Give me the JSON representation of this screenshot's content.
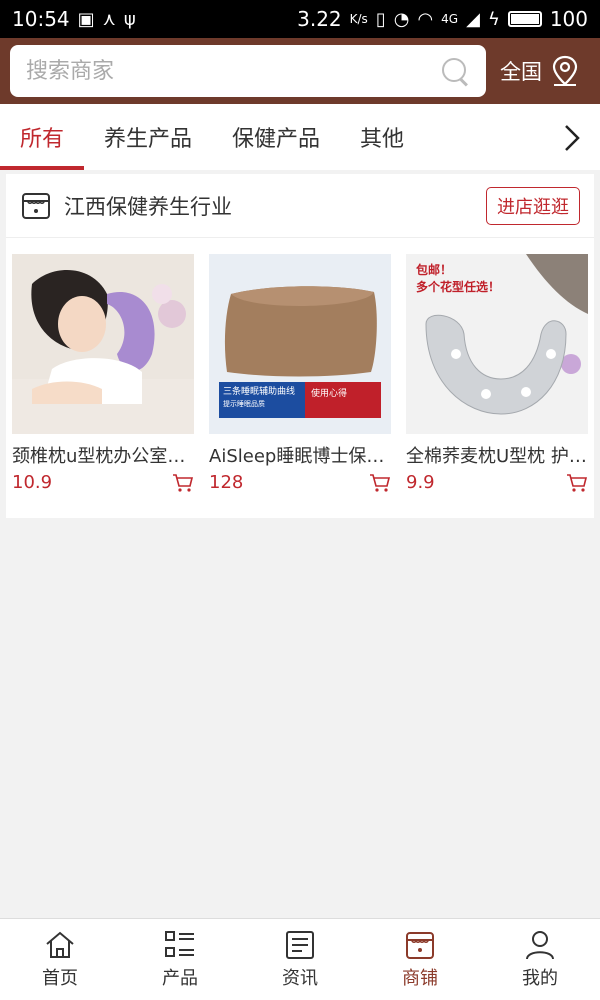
{
  "statusbar": {
    "time": "10:54",
    "speed": "3.22",
    "speed_unit": "K/s",
    "network": "4G",
    "battery": "100"
  },
  "search": {
    "placeholder": "搜索商家"
  },
  "region": {
    "label": "全国"
  },
  "tabs": [
    {
      "label": "所有"
    },
    {
      "label": "养生产品"
    },
    {
      "label": "保健产品"
    },
    {
      "label": "其他"
    }
  ],
  "shop": {
    "name": "江西保健养生行业",
    "visit_label": "进店逛逛",
    "products": [
      {
        "title": "颈椎枕u型枕办公室午睡枕",
        "price": "10.9"
      },
      {
        "title": "AiSleep睡眠博士保健枕",
        "price": "128"
      },
      {
        "title": "全棉荞麦枕U型枕 护颈枕",
        "price": "9.9"
      }
    ],
    "image_texts": {
      "p2_banner_left": "三条睡眠辅助曲线",
      "p2_banner_left_sub": "提示睡眠品质",
      "p2_banner_right": "使用心得",
      "p3_line1": "包邮！",
      "p3_line2": "多个花型任选！"
    }
  },
  "nav": [
    {
      "label": "首页"
    },
    {
      "label": "产品"
    },
    {
      "label": "资讯"
    },
    {
      "label": "商铺"
    },
    {
      "label": "我的"
    }
  ],
  "colors": {
    "brand": "#6e3a2b",
    "accent": "#c0282e",
    "active_nav": "#8b3a2a"
  }
}
